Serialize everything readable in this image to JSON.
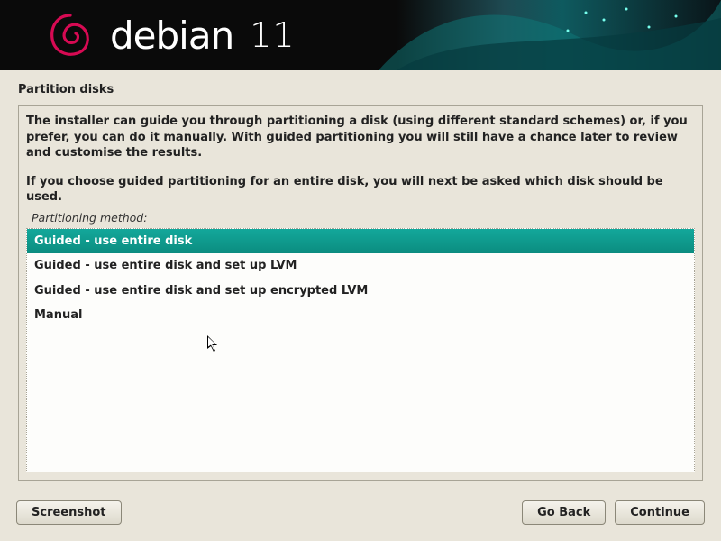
{
  "brand": {
    "name": "debian",
    "version": "11"
  },
  "title": "Partition disks",
  "help_text_1": "The installer can guide you through partitioning a disk (using different standard schemes) or, if you prefer, you can do it manually. With guided partitioning you will still have a chance later to review and customise the results.",
  "help_text_2": "If you choose guided partitioning for an entire disk, you will next be asked which disk should be used.",
  "method_label": "Partitioning method:",
  "options": {
    "0": "Guided - use entire disk",
    "1": "Guided - use entire disk and set up LVM",
    "2": "Guided - use entire disk and set up encrypted LVM",
    "3": "Manual"
  },
  "selected_index": 0,
  "buttons": {
    "screenshot": "Screenshot",
    "go_back": "Go Back",
    "continue": "Continue"
  }
}
